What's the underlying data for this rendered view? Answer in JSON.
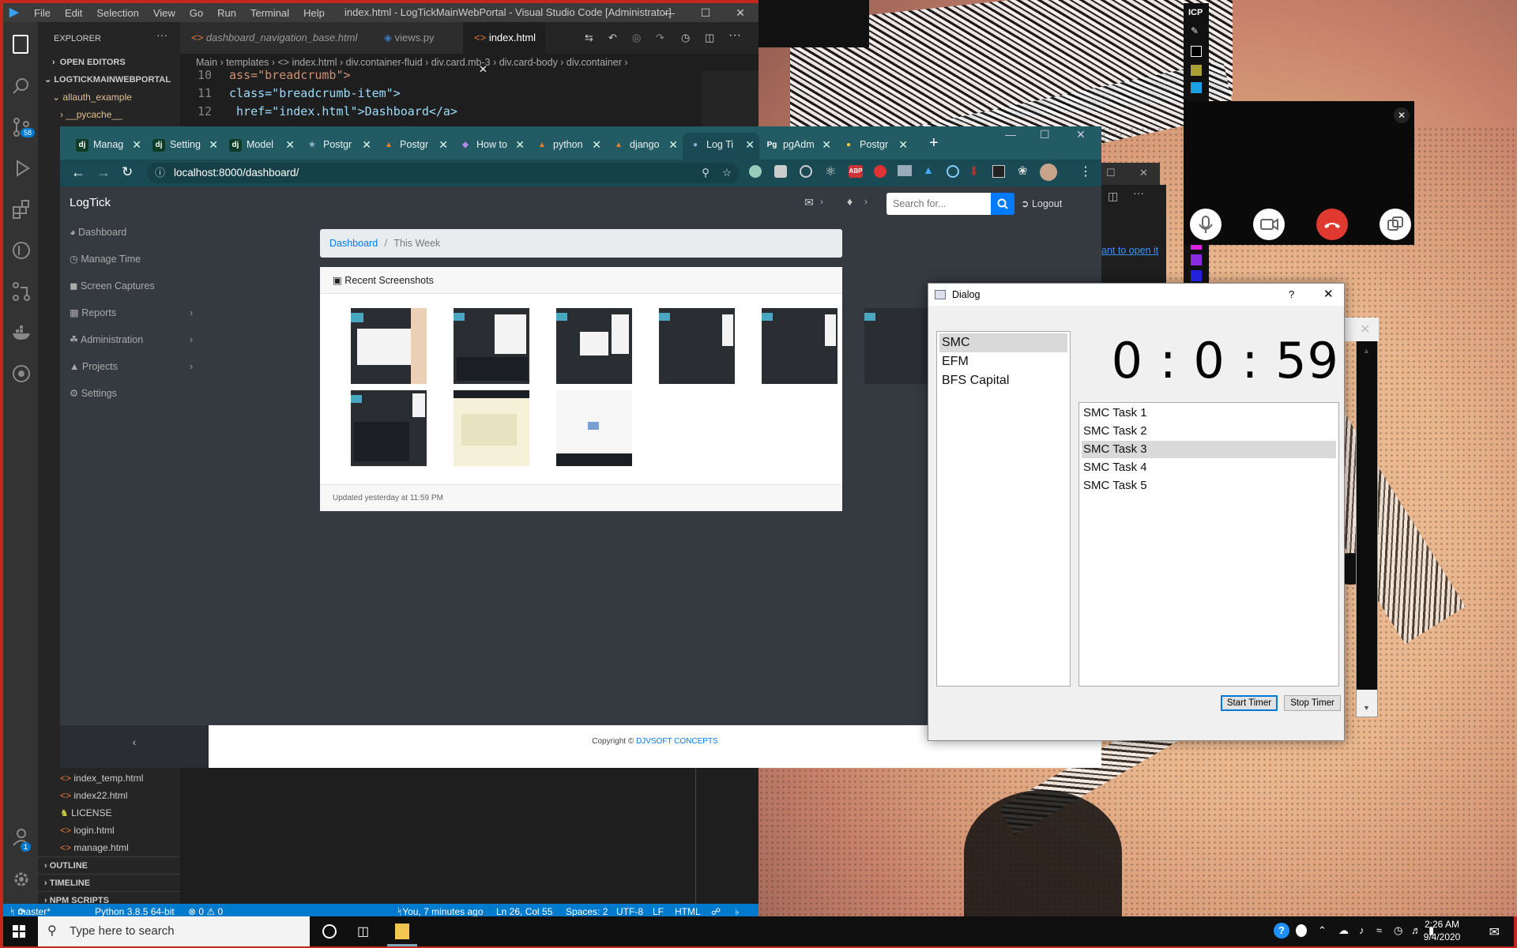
{
  "vscode": {
    "title": "index.html - LogTickMainWebPortal - Visual Studio Code [Administrator]",
    "menu": [
      "File",
      "Edit",
      "Selection",
      "View",
      "Go",
      "Run",
      "Terminal",
      "Help"
    ],
    "explorer_label": "EXPLORER",
    "open_editors": "OPEN EDITORS",
    "project": "LOGTICKMAINWEBPORTAL",
    "tree_top": [
      "allauth_example",
      "__pycache__"
    ],
    "tree_bottom": [
      "index_temp.html",
      "index22.html",
      "LICENSE",
      "login.html",
      "manage.html"
    ],
    "sections": [
      "OUTLINE",
      "TIMELINE",
      "NPM SCRIPTS"
    ],
    "scm_badge": "58",
    "account_badge": "1",
    "tabs": [
      "dashboard_navigation_base.html",
      "views.py",
      "index.html"
    ],
    "breadcrumbs": "Main › templates › <> index.html › div.container-fluid › div.card.mb-3 › div.card-body › div.container ›",
    "code": [
      {
        "ln": "10",
        "text": "ass=\"breadcrumb\">"
      },
      {
        "ln": "11",
        "text": "class=\"breadcrumb-item\">"
      },
      {
        "ln": "12",
        "text": " href=\"index.html\">Dashboard</a>"
      }
    ],
    "status": {
      "branch": "master*",
      "python": "Python 3.8.5 64-bit",
      "problems": "⊗ 0 ⚠ 0",
      "blame": "You, 7 minutes ago",
      "position": "Ln 26, Col 55",
      "spaces": "Spaces: 2",
      "encoding": "UTF-8",
      "eol": "LF",
      "language": "HTML"
    }
  },
  "chrome": {
    "tabs": [
      {
        "label": "Manag",
        "icon": "dj"
      },
      {
        "label": "Setting",
        "icon": "dj"
      },
      {
        "label": "Model",
        "icon": "dj"
      },
      {
        "label": "Postgr",
        "icon": "★"
      },
      {
        "label": "Postgr",
        "icon": "▲"
      },
      {
        "label": "How to",
        "icon": "◆"
      },
      {
        "label": "python",
        "icon": "▲"
      },
      {
        "label": "django",
        "icon": "▲"
      },
      {
        "label": "Log Ti",
        "icon": "●"
      },
      {
        "label": "pgAdm",
        "icon": "Pg"
      },
      {
        "label": "Postgr",
        "icon": "●"
      }
    ],
    "url": "localhost:8000/dashboard/"
  },
  "logtick": {
    "brand": "LogTick",
    "search_placeholder": "Search for...",
    "logout": "Logout",
    "nav": [
      "Dashboard",
      "Manage Time",
      "Screen Captures",
      "Reports",
      "Administration",
      "Projects",
      "Settings"
    ],
    "breadcrumb_link": "Dashboard",
    "breadcrumb_sep": "/",
    "breadcrumb_current": "This Week",
    "card_title": "Recent Screenshots",
    "card_footer": "Updated yesterday at 11:59 PM",
    "footer_text": "Copyright ©",
    "footer_link": "DJVSOFT CONCEPTS",
    "toggle": "‹"
  },
  "background_window": {
    "link_text": "ant to open it"
  },
  "dialog": {
    "title": "Dialog",
    "help": "?",
    "clients": [
      "SMC",
      "EFM",
      "BFS Capital"
    ],
    "selected_client": "SMC",
    "timer": "0 : 0 : 59",
    "tasks": [
      "SMC Task 1",
      "SMC Task 2",
      "SMC Task 3",
      "SMC Task 4",
      "SMC Task 5"
    ],
    "selected_task": "SMC Task 3",
    "start_button": "Start Timer",
    "stop_button": "Stop Timer"
  },
  "call_overlay": {
    "label": "ICP"
  },
  "taskbar": {
    "search_placeholder": "Type here to search",
    "time": "2:26 AM",
    "date": "9/4/2020"
  },
  "colors": {
    "desktop_border": "#c4271d",
    "vscode_status": "#007acc",
    "chrome_frame": "#235b65",
    "logtick_dark": "#343a40",
    "primary": "#007bff",
    "end_call": "#e0392f"
  }
}
